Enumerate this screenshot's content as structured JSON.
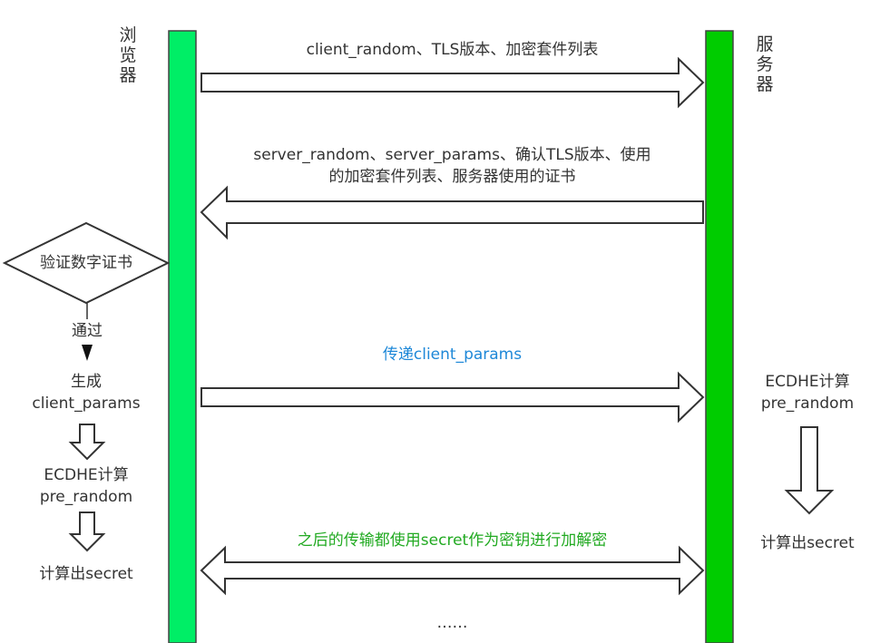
{
  "participants": {
    "browser": {
      "label": "浏览器",
      "color": "#00ee66"
    },
    "server": {
      "label": "服务器",
      "color": "#00cc00"
    }
  },
  "messages": {
    "m1": {
      "label": "client_random、TLS版本、加密套件列表"
    },
    "m2": {
      "line1": "server_random、server_params、确认TLS版本、使用",
      "line2": "的加密套件列表、服务器使用的证书"
    },
    "m3": {
      "label": "传递client_params",
      "color": "#1e88d8"
    },
    "m4": {
      "label": "之后的传输都使用secret作为密钥进行加解密",
      "color": "#22aa22"
    },
    "ellipsis": "……"
  },
  "browser_steps": {
    "decision": "验证数字证书",
    "pass_label": "通过",
    "generate_line1": "生成",
    "generate_line2": "client_params",
    "ecdhe_line1": "ECDHE计算",
    "ecdhe_line2": "pre_random",
    "secret": "计算出secret"
  },
  "server_steps": {
    "ecdhe_line1": "ECDHE计算",
    "ecdhe_line2": "pre_random",
    "secret": "计算出secret"
  }
}
